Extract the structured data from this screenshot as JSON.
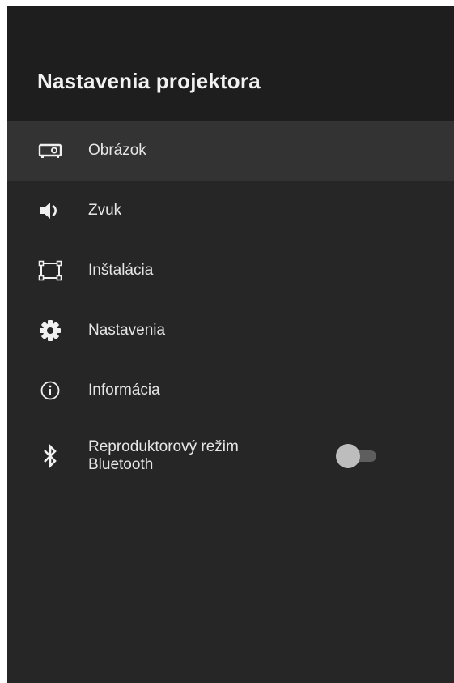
{
  "header": {
    "title": "Nastavenia projektora"
  },
  "menu": {
    "items": [
      {
        "label": "Obrázok",
        "icon": "projector-icon",
        "selected": true
      },
      {
        "label": "Zvuk",
        "icon": "speaker-volume-icon"
      },
      {
        "label": "Inštalácia",
        "icon": "frame-corners-icon"
      },
      {
        "label": "Nastavenia",
        "icon": "gear-icon"
      },
      {
        "label": "Informácia",
        "icon": "info-icon"
      }
    ],
    "bluetooth": {
      "label_line1": "Reproduktorový režim",
      "label_line2": "Bluetooth",
      "icon": "bluetooth-icon",
      "toggle_on": false
    }
  },
  "colors": {
    "background": "#262626",
    "header_background": "#1e1e1e",
    "selected_row": "#333333",
    "text": "#e6e6e6"
  }
}
